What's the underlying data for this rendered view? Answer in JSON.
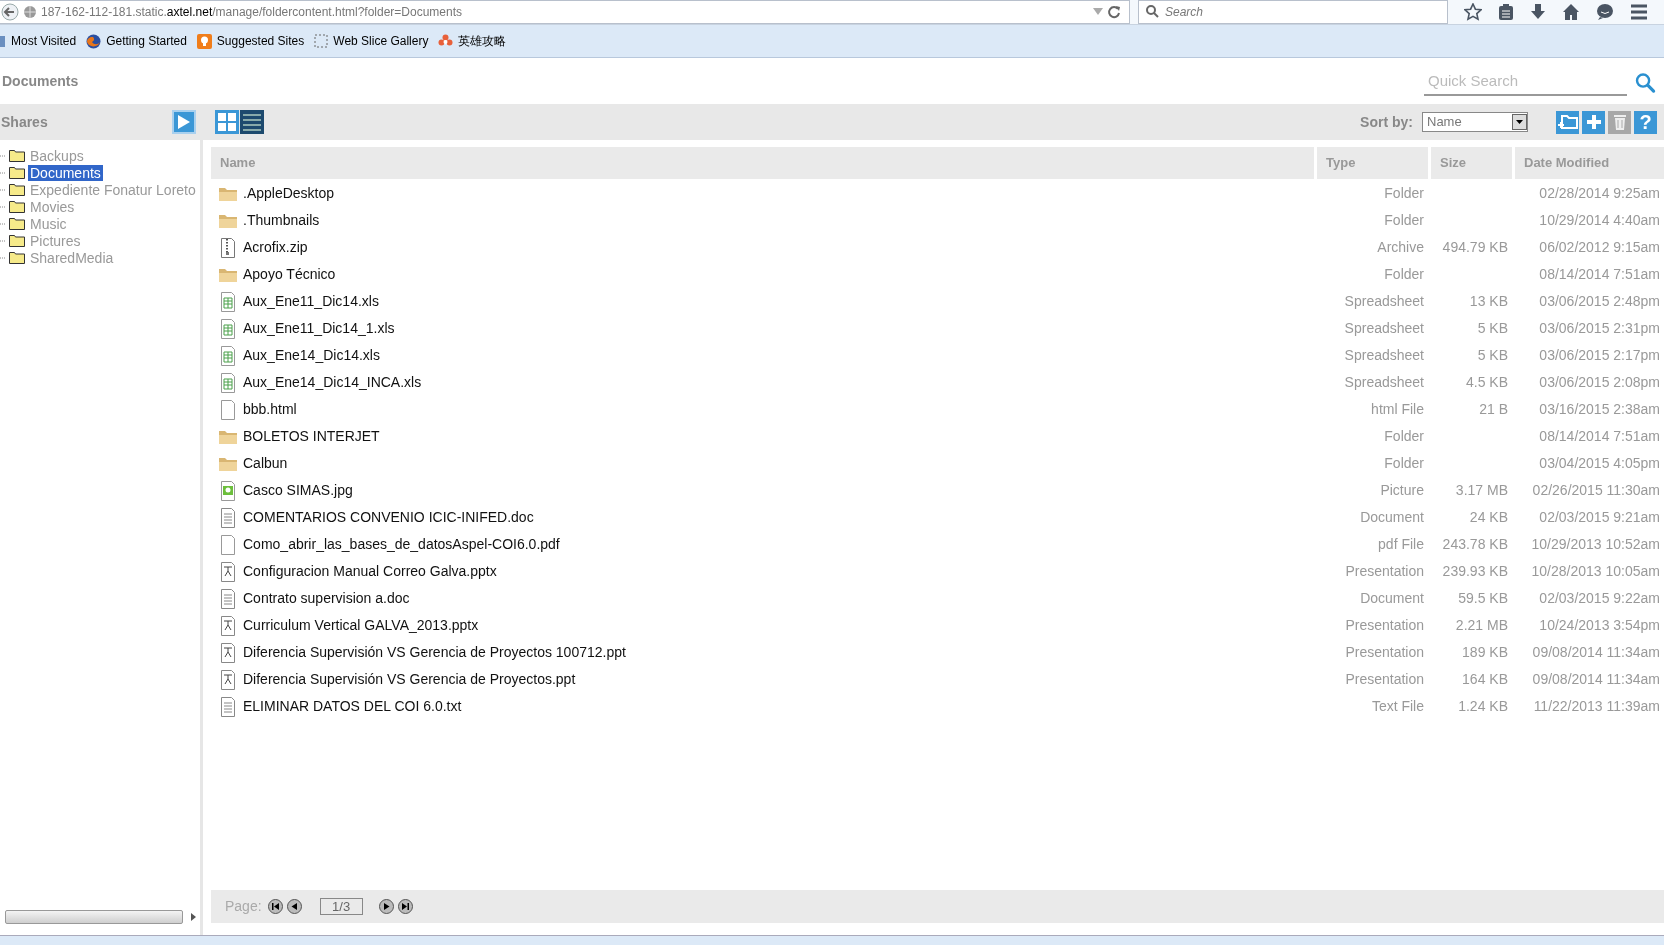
{
  "browser": {
    "url_prefix": "187-162-112-181.static.",
    "url_domain": "axtel.net",
    "url_path": "/manage/foldercontent.html?folder=Documents",
    "search_placeholder": "Search",
    "bookmarks": [
      {
        "label": "Most Visited",
        "kind": "folder"
      },
      {
        "label": "Getting Started",
        "kind": "firefox"
      },
      {
        "label": "Suggested Sites",
        "kind": "bulb"
      },
      {
        "label": "Web Slice Gallery",
        "kind": "slice"
      },
      {
        "label": "英雄攻略",
        "kind": "game"
      }
    ]
  },
  "header": {
    "title": "Documents",
    "quick_search_placeholder": "Quick Search"
  },
  "sidebar": {
    "title": "Shares",
    "items": [
      {
        "label": "Backups",
        "selected": false
      },
      {
        "label": "Documents",
        "selected": true
      },
      {
        "label": "Expediente Fonatur Loreto",
        "selected": false
      },
      {
        "label": "Movies",
        "selected": false
      },
      {
        "label": "Music",
        "selected": false
      },
      {
        "label": "Pictures",
        "selected": false
      },
      {
        "label": "SharedMedia",
        "selected": false
      }
    ]
  },
  "toolbar": {
    "views": [
      {
        "kind": "grid",
        "selected": false
      },
      {
        "kind": "list",
        "selected": true
      }
    ],
    "sort_label": "Sort by:",
    "sort_value": "Name",
    "actions": [
      {
        "kind": "new-folder",
        "disabled": false
      },
      {
        "kind": "add",
        "disabled": false
      },
      {
        "kind": "delete",
        "disabled": true
      },
      {
        "kind": "help",
        "disabled": false,
        "label": "?"
      }
    ]
  },
  "table": {
    "columns": [
      "Name",
      "Type",
      "Size",
      "Date Modified"
    ],
    "rows": [
      {
        "kind": "folder",
        "name": ".AppleDesktop",
        "type": "Folder",
        "date": "02/28/2014 9:25am"
      },
      {
        "kind": "folder",
        "name": ".Thumbnails",
        "type": "Folder",
        "date": "10/29/2014 4:40am"
      },
      {
        "kind": "zip",
        "name": "Acrofix.zip",
        "type": "Archive",
        "size": "494.79 KB",
        "date": "06/02/2012 9:15am"
      },
      {
        "kind": "folder",
        "name": "Apoyo Técnico",
        "type": "Folder",
        "date": "08/14/2014 7:51am"
      },
      {
        "kind": "sheet",
        "name": "Aux_Ene11_Dic14.xls",
        "type": "Spreadsheet",
        "size": "13 KB",
        "date": "03/06/2015 2:48pm"
      },
      {
        "kind": "sheet",
        "name": "Aux_Ene11_Dic14_1.xls",
        "type": "Spreadsheet",
        "size": "5 KB",
        "date": "03/06/2015 2:31pm"
      },
      {
        "kind": "sheet",
        "name": "Aux_Ene14_Dic14.xls",
        "type": "Spreadsheet",
        "size": "5 KB",
        "date": "03/06/2015 2:17pm"
      },
      {
        "kind": "sheet",
        "name": "Aux_Ene14_Dic14_INCA.xls",
        "type": "Spreadsheet",
        "size": "4.5 KB",
        "date": "03/06/2015 2:08pm"
      },
      {
        "kind": "blank",
        "name": "bbb.html",
        "type": "html File",
        "size": "21 B",
        "date": "03/16/2015 2:38am"
      },
      {
        "kind": "folder",
        "name": "BOLETOS INTERJET",
        "type": "Folder",
        "date": "08/14/2014 7:51am"
      },
      {
        "kind": "folder",
        "name": "Calbun",
        "type": "Folder",
        "date": "03/04/2015 4:05pm"
      },
      {
        "kind": "picture",
        "name": "Casco SIMAS.jpg",
        "type": "Picture",
        "size": "3.17 MB",
        "date": "02/26/2015 11:30am"
      },
      {
        "kind": "doc",
        "name": "COMENTARIOS CONVENIO ICIC-INIFED.doc",
        "type": "Document",
        "size": "24 KB",
        "date": "02/03/2015 9:21am"
      },
      {
        "kind": "blank",
        "name": "Como_abrir_las_bases_de_datosAspel-COI6.0.pdf",
        "type": "pdf File",
        "size": "243.78 KB",
        "date": "10/29/2013 10:52am"
      },
      {
        "kind": "slides",
        "name": "Configuracion Manual Correo Galva.pptx",
        "type": "Presentation",
        "size": "239.93 KB",
        "date": "10/28/2013 10:05am"
      },
      {
        "kind": "doc",
        "name": "Contrato supervision a.doc",
        "type": "Document",
        "size": "59.5 KB",
        "date": "02/03/2015 9:22am"
      },
      {
        "kind": "slides",
        "name": "Curriculum Vertical GALVA_2013.pptx",
        "type": "Presentation",
        "size": "2.21 MB",
        "date": "10/24/2013 3:54pm"
      },
      {
        "kind": "slides",
        "name": "Diferencia Supervisión VS Gerencia de Proyectos 100712.ppt",
        "type": "Presentation",
        "size": "189 KB",
        "date": "09/08/2014 11:34am"
      },
      {
        "kind": "slides",
        "name": "Diferencia Supervisión VS Gerencia de Proyectos.ppt",
        "type": "Presentation",
        "size": "164 KB",
        "date": "09/08/2014 11:34am"
      },
      {
        "kind": "doc",
        "name": "ELIMINAR DATOS DEL COI 6.0.txt",
        "type": "Text File",
        "size": "1.24 KB",
        "date": "11/22/2013 11:39am"
      }
    ]
  },
  "pager": {
    "label": "Page:",
    "value": "1/3"
  }
}
